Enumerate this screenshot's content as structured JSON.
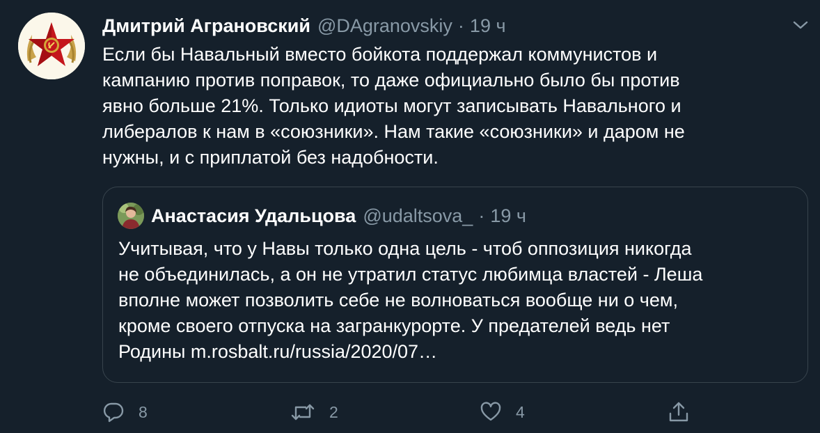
{
  "tweet": {
    "author_name": "Дмитрий Аграновский",
    "author_handle": "@DAgranovskiy",
    "separator": "·",
    "time": "19 ч",
    "text_lines": [
      "Если бы Навальный вместо бойкота поддержал коммунистов и",
      "кампанию против поправок, то даже официально было бы против",
      "явно больше 21%. Только идиоты могут записывать Навального и",
      "либералов к нам в «союзники». Нам такие «союзники» и даром не",
      "нужны, и с приплатой без надобности."
    ]
  },
  "quoted_tweet": {
    "author_name": "Анастасия Удальцова",
    "author_handle": "@udaltsova_",
    "separator": "·",
    "time": "19 ч",
    "text_lines": [
      "Учитывая, что у Навы только одна цель - чтоб оппозиция никогда",
      "не объединилась, а он не утратил статус любимца властей - Леша",
      "вполне может позволить себе не волноваться вообще ни о чем,",
      "кроме своего отпуска на загранкурорте. У предателей ведь нет",
      "Родины m.rosbalt.ru/russia/2020/07…"
    ]
  },
  "actions": {
    "reply_count": "8",
    "retweet_count": "2",
    "like_count": "4"
  },
  "icons": {
    "caret": "chevron-down-icon",
    "reply": "reply-icon",
    "retweet": "retweet-icon",
    "like": "heart-icon",
    "share": "share-icon"
  },
  "colors": {
    "background": "#15202b",
    "secondary_text": "#8899a6",
    "border": "#38444d",
    "primary_text": "#ffffff"
  }
}
